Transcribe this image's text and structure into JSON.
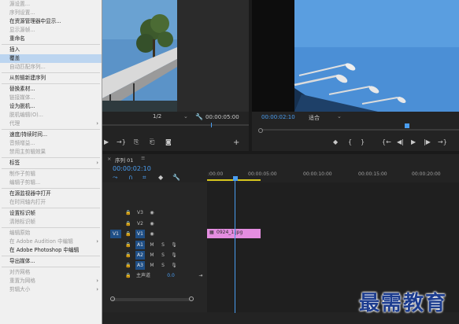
{
  "context_menu": {
    "items": [
      {
        "label": "源设置...",
        "disabled": true
      },
      {
        "label": "序列设置...",
        "disabled": true
      },
      {
        "label": "在资源管理器中显示...",
        "disabled": false
      },
      {
        "label": "显示源帧...",
        "disabled": true
      },
      {
        "label": "重命名",
        "disabled": false
      },
      {
        "label": "插入",
        "disabled": false
      },
      {
        "label": "覆盖",
        "disabled": false,
        "highlighted": true
      },
      {
        "label": "自动匹配序列...",
        "disabled": true
      },
      {
        "label": "从剪辑新建序列",
        "disabled": false
      },
      {
        "label": "替换素材...",
        "disabled": false
      },
      {
        "label": "链接媒体...",
        "disabled": true
      },
      {
        "label": "设为脱机...",
        "disabled": false
      },
      {
        "label": "脱机编辑(O)...",
        "disabled": true
      },
      {
        "label": "代理",
        "disabled": true,
        "submenu": true
      },
      {
        "label": "速度/持续时间...",
        "disabled": false
      },
      {
        "label": "音频增益...",
        "disabled": true
      },
      {
        "label": "禁用主剪辑效果",
        "disabled": true
      },
      {
        "label": "标签",
        "disabled": false,
        "submenu": true
      },
      {
        "label": "制作子剪辑",
        "disabled": true
      },
      {
        "label": "编辑子剪辑...",
        "disabled": true
      },
      {
        "label": "在源监视器中打开",
        "disabled": false
      },
      {
        "label": "在时间轴内打开",
        "disabled": true
      },
      {
        "label": "设置标识帧",
        "disabled": false
      },
      {
        "label": "清除标识帧",
        "disabled": true
      },
      {
        "label": "编辑原始",
        "disabled": true
      },
      {
        "label": "在 Adobe Audition 中编辑",
        "disabled": true,
        "submenu": true
      },
      {
        "label": "在 Adobe Photoshop 中编辑",
        "disabled": false
      },
      {
        "label": "导出媒体...",
        "disabled": false
      },
      {
        "label": "对齐网格",
        "disabled": true
      },
      {
        "label": "重置为网格",
        "disabled": true,
        "submenu": true
      },
      {
        "label": "剪辑大小",
        "disabled": true,
        "submenu": true
      }
    ]
  },
  "source_monitor": {
    "fraction": "1/2",
    "timecode": "00:00:05:00"
  },
  "program_monitor": {
    "timecode": "00:00:02:10",
    "fit": "适合"
  },
  "timeline": {
    "tab_label": "序列 01",
    "timecode": "00:00:02:10",
    "ruler": [
      ":00:00",
      "00:00:05:00",
      "00:00:10:00",
      "00:00:15:00",
      "00:00:20:00"
    ],
    "video_tracks": [
      "V3",
      "V2",
      "V1"
    ],
    "audio_tracks": [
      "A1",
      "A2",
      "A3"
    ],
    "source_patch_video": "V1",
    "master_label": "主声道",
    "master_value": "0.0",
    "clip_name": "0924_1.jpg",
    "clip_color": "#e48de0",
    "track_toggles": {
      "mute": "M",
      "solo": "S"
    }
  },
  "watermark": "最需教育",
  "colors": {
    "accent_blue": "#4a9df0",
    "menu_highlight": "#bcd5f0"
  }
}
